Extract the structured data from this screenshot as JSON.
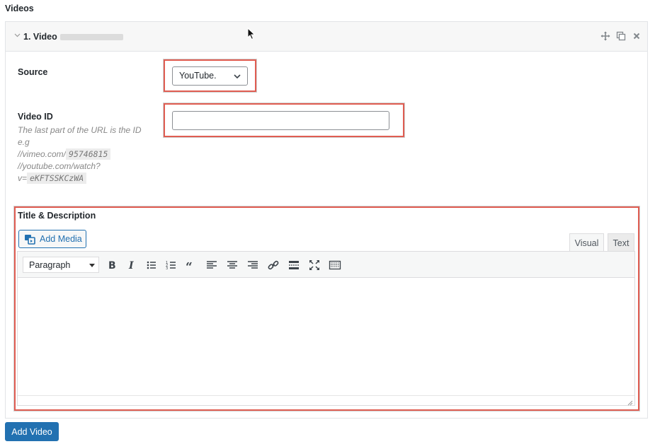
{
  "section": {
    "title": "Videos"
  },
  "item": {
    "title": "1. Video"
  },
  "header_icons": [
    "move-icon",
    "duplicate-icon",
    "close-icon"
  ],
  "fields": {
    "source": {
      "label": "Source",
      "value": "YouTube."
    },
    "video_id": {
      "label": "Video ID",
      "value": "",
      "description_1": "The last part of the URL is the ID e.g",
      "vimeo_prefix": "//vimeo.com/",
      "vimeo_code": "95746815",
      "youtube_prefix": "//youtube.com/watch?",
      "youtube_param": "v=",
      "youtube_code": "eKFTSSKCzWA"
    },
    "title_description": {
      "label": "Title & Description"
    }
  },
  "editor": {
    "add_media_label": "Add Media",
    "tabs": {
      "visual": "Visual",
      "text": "Text"
    },
    "format_value": "Paragraph",
    "toolbar_icons": [
      "bold-icon",
      "italic-icon",
      "bullet-list-icon",
      "numbered-list-icon",
      "blockquote-icon",
      "align-left-icon",
      "align-center-icon",
      "align-right-icon",
      "link-icon",
      "read-more-icon",
      "fullscreen-icon",
      "toolbar-toggle-icon"
    ],
    "content": ""
  },
  "actions": {
    "add_video_label": "Add Video"
  },
  "colors": {
    "primary": "#2271b1",
    "highlight": "#e05d52"
  }
}
